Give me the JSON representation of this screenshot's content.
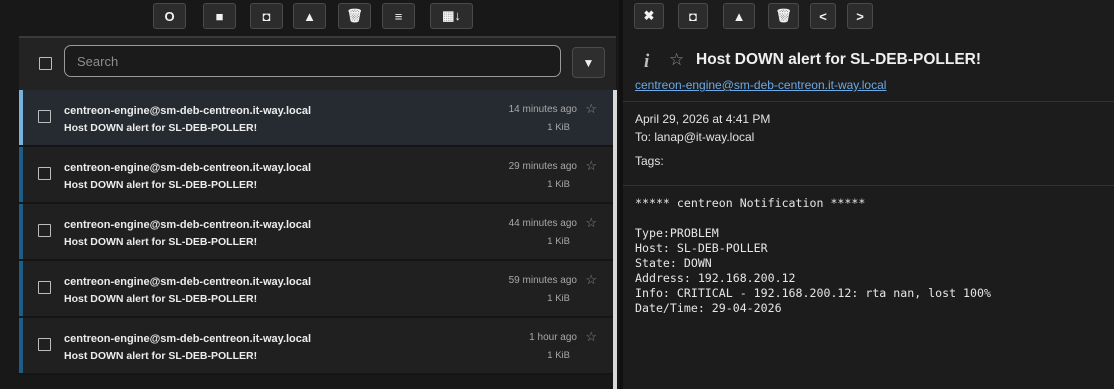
{
  "left_toolbar": {
    "buttons": [
      {
        "name": "refresh-icon",
        "glyph": "O"
      },
      {
        "name": "folder-icon",
        "glyph": "■"
      },
      {
        "name": "archive-icon",
        "glyph": "◘"
      },
      {
        "name": "warning-icon",
        "glyph": "▲"
      },
      {
        "name": "trash-icon",
        "glyph": "🗑"
      },
      {
        "name": "menu-icon",
        "glyph": "≡"
      },
      {
        "name": "calendar-sort-icon",
        "glyph": "▦↓"
      }
    ]
  },
  "search": {
    "placeholder": "Search",
    "filter_glyph": "▼"
  },
  "messages": [
    {
      "from": "centreon-engine@sm-deb-centreon.it-way.local",
      "subject": "Host DOWN alert for SL-DEB-POLLER!",
      "time": "14 minutes ago",
      "size": "1 KiB",
      "active": true
    },
    {
      "from": "centreon-engine@sm-deb-centreon.it-way.local",
      "subject": "Host DOWN alert for SL-DEB-POLLER!",
      "time": "29 minutes ago",
      "size": "1 KiB",
      "active": false
    },
    {
      "from": "centreon-engine@sm-deb-centreon.it-way.local",
      "subject": "Host DOWN alert for SL-DEB-POLLER!",
      "time": "44 minutes ago",
      "size": "1 KiB",
      "active": false
    },
    {
      "from": "centreon-engine@sm-deb-centreon.it-way.local",
      "subject": "Host DOWN alert for SL-DEB-POLLER!",
      "time": "59 minutes ago",
      "size": "1 KiB",
      "active": false
    },
    {
      "from": "centreon-engine@sm-deb-centreon.it-way.local",
      "subject": "Host DOWN alert for SL-DEB-POLLER!",
      "time": "1 hour ago",
      "size": "1 KiB",
      "active": false
    }
  ],
  "right_toolbar": {
    "buttons": [
      {
        "name": "close-icon",
        "glyph": "✖"
      },
      {
        "name": "archive-icon",
        "glyph": "◘"
      },
      {
        "name": "warning-icon",
        "glyph": "▲"
      },
      {
        "name": "trash-icon",
        "glyph": "🗑"
      },
      {
        "name": "previous-icon",
        "glyph": "<"
      },
      {
        "name": "next-icon",
        "glyph": ">"
      }
    ]
  },
  "message_view": {
    "info_glyph": "i",
    "star_glyph": "☆",
    "subject": "Host DOWN alert for SL-DEB-POLLER!",
    "from": "centreon-engine@sm-deb-centreon.it-way.local",
    "date": "April 29, 2026 at 4:41 PM",
    "to": "To: lanap@it-way.local",
    "tags": "Tags:",
    "body": "***** centreon Notification *****\n\nType:PROBLEM\nHost: SL-DEB-POLLER\nState: DOWN\nAddress: 192.168.200.12\nInfo: CRITICAL - 192.168.200.12: rta nan, lost 100%\nDate/Time: 29-04-2026"
  },
  "colors": {
    "accent_bar": "#1f5d89",
    "accent_bar_active": "#78b3e0",
    "link": "#6aa9e6"
  }
}
